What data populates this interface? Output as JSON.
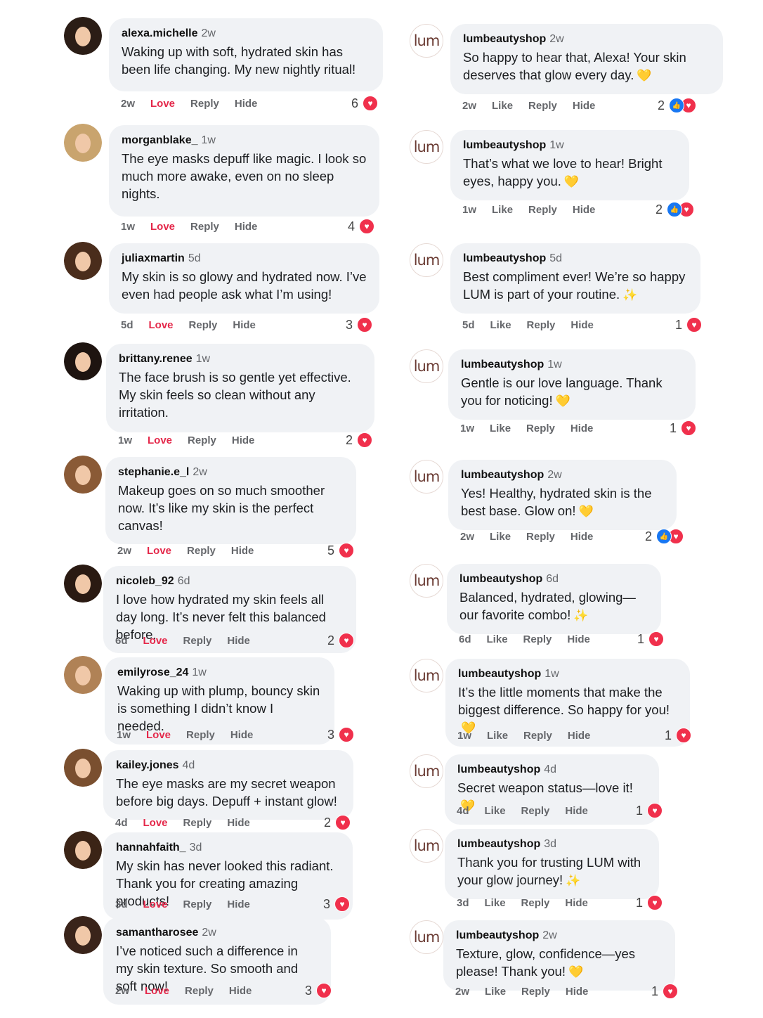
{
  "left": [
    {
      "user": "alexa.michelle",
      "time": "2w",
      "text": "Waking up with soft, hydrated skin has been life changing. My new nightly ritual!",
      "actions": {
        "time": "2w",
        "love": "Love",
        "reply": "Reply",
        "hide": "Hide"
      },
      "count": "6"
    },
    {
      "user": "morganblake_",
      "time": "1w",
      "text": "The eye masks depuff like magic. I look so much more awake, even on no sleep nights.",
      "actions": {
        "time": "1w",
        "love": "Love",
        "reply": "Reply",
        "hide": "Hide"
      },
      "count": "4"
    },
    {
      "user": "juliaxmartin",
      "time": "5d",
      "text": "My skin is so glowy and hydrated now. I’ve even had people ask what I’m using!",
      "actions": {
        "time": "5d",
        "love": "Love",
        "reply": "Reply",
        "hide": "Hide"
      },
      "count": "3"
    },
    {
      "user": "brittany.renee",
      "time": "1w",
      "text": "The face brush is so gentle yet effective. My skin feels so clean without any irritation.",
      "actions": {
        "time": "1w",
        "love": "Love",
        "reply": "Reply",
        "hide": "Hide"
      },
      "count": "2"
    },
    {
      "user": "stephanie.e_l",
      "time": "2w",
      "text": "Makeup goes on so much smoother now. It’s like my skin is the perfect canvas!",
      "actions": {
        "time": "2w",
        "love": "Love",
        "reply": "Reply",
        "hide": "Hide"
      },
      "count": "5"
    },
    {
      "user": "nicoleb_92",
      "time": "6d",
      "text": "I love how hydrated my skin feels all day long. It’s never felt this balanced before.",
      "actions": {
        "time": "6d",
        "love": "Love",
        "reply": "Reply",
        "hide": "Hide"
      },
      "count": "2"
    },
    {
      "user": "emilyrose_24",
      "time": "1w",
      "text": "Waking up with plump, bouncy skin is something I didn’t know I needed.",
      "actions": {
        "time": "1w",
        "love": "Love",
        "reply": "Reply",
        "hide": "Hide"
      },
      "count": "3"
    },
    {
      "user": "kailey.jones",
      "time": "4d",
      "text": "The eye masks are my secret weapon before big days. Depuff + instant glow!",
      "actions": {
        "time": "4d",
        "love": "Love",
        "reply": "Reply",
        "hide": "Hide"
      },
      "count": "2"
    },
    {
      "user": "hannahfaith_",
      "time": "3d",
      "text": "My skin has never looked this radiant. Thank you for creating amazing products!",
      "actions": {
        "time": "3d",
        "love": "Love",
        "reply": "Reply",
        "hide": "Hide"
      },
      "count": "3"
    },
    {
      "user": "samantharosee",
      "time": "2w",
      "text": "I’ve noticed such a difference in my skin texture. So smooth and soft now!",
      "actions": {
        "time": "2w",
        "love": "Love",
        "reply": "Reply",
        "hide": "Hide"
      },
      "count": "3"
    }
  ],
  "right": [
    {
      "logo": "lum",
      "user": "lumbeautyshop",
      "time": "2w",
      "text": "So happy to hear that, Alexa! Your skin deserves that glow every day.",
      "emoji": "💛",
      "actions": {
        "time": "2w",
        "like": "Like",
        "reply": "Reply",
        "hide": "Hide"
      },
      "count": "2",
      "liked": true
    },
    {
      "logo": "lum",
      "user": "lumbeautyshop",
      "time": "1w",
      "text": "That’s what we love to hear! Bright eyes, happy you.",
      "emoji": "💛",
      "actions": {
        "time": "1w",
        "like": "Like",
        "reply": "Reply",
        "hide": "Hide"
      },
      "count": "2",
      "liked": true
    },
    {
      "logo": "lum",
      "user": "lumbeautyshop",
      "time": "5d",
      "text": "Best compliment ever! We’re so happy LUM is part of your routine.",
      "emoji": "✨",
      "actions": {
        "time": "5d",
        "like": "Like",
        "reply": "Reply",
        "hide": "Hide"
      },
      "count": "1",
      "liked": false
    },
    {
      "logo": "lum",
      "user": "lumbeautyshop",
      "time": "1w",
      "text": "Gentle is our love language. Thank you for noticing!",
      "emoji": "💛",
      "actions": {
        "time": "1w",
        "like": "Like",
        "reply": "Reply",
        "hide": "Hide"
      },
      "count": "1",
      "liked": false
    },
    {
      "logo": "lum",
      "user": "lumbeautyshop",
      "time": "2w",
      "text": "Yes! Healthy, hydrated skin is the best base. Glow on!",
      "emoji": "💛",
      "actions": {
        "time": "2w",
        "like": "Like",
        "reply": "Reply",
        "hide": "Hide"
      },
      "count": "2",
      "liked": true
    },
    {
      "logo": "lum",
      "user": "lumbeautyshop",
      "time": "6d",
      "text": "Balanced, hydrated, glowing—our favorite combo!",
      "emoji": "✨",
      "actions": {
        "time": "6d",
        "like": "Like",
        "reply": "Reply",
        "hide": "Hide"
      },
      "count": "1",
      "liked": false
    },
    {
      "logo": "lum",
      "user": "lumbeautyshop",
      "time": "1w",
      "text": "It’s the little moments that make the biggest difference. So happy for you!",
      "emoji": "💛",
      "actions": {
        "time": "1w",
        "like": "Like",
        "reply": "Reply",
        "hide": "Hide"
      },
      "count": "1",
      "liked": false
    },
    {
      "logo": "lum",
      "user": "lumbeautyshop",
      "time": "4d",
      "text": "Secret weapon status—love it!",
      "emoji": "💛",
      "actions": {
        "time": "4d",
        "like": "Like",
        "reply": "Reply",
        "hide": "Hide"
      },
      "count": "1",
      "liked": false
    },
    {
      "logo": "lum",
      "user": "lumbeautyshop",
      "time": "3d",
      "text": "Thank you for trusting LUM with your glow journey!",
      "emoji": "✨",
      "actions": {
        "time": "3d",
        "like": "Like",
        "reply": "Reply",
        "hide": "Hide"
      },
      "count": "1",
      "liked": false
    },
    {
      "logo": "lum",
      "user": "lumbeautyshop",
      "time": "2w",
      "text": "Texture, glow, confidence—yes please! Thank you!",
      "emoji": "💛",
      "actions": {
        "time": "2w",
        "like": "Like",
        "reply": "Reply",
        "hide": "Hide"
      },
      "count": "1",
      "liked": false
    }
  ],
  "colors": {
    "love": "#e4284a",
    "heart": "#f0304c",
    "like": "#1877f2",
    "bubble": "#f0f2f5"
  },
  "icons": {
    "heart": "heart-icon",
    "like": "thumbs-up-icon"
  }
}
